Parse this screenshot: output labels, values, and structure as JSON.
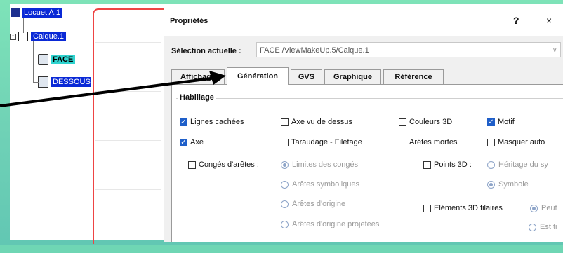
{
  "tree": {
    "root": "Locuet A.1",
    "calque": "Calque.1",
    "face": "FACE",
    "dessous": "DESSOUS"
  },
  "dialog": {
    "title": "Propriétés",
    "help": "?",
    "close": "×",
    "selection_label": "Sélection actuelle :",
    "selection_value": "FACE /ViewMakeUp.5/Calque.1",
    "tabs": [
      "Affichage",
      "Génération",
      "GVS",
      "Graphique",
      "Référence"
    ],
    "active_tab": "Génération",
    "group_title": "Habillage",
    "options": {
      "lignes_cachees": "Lignes cachées",
      "axe_vu_dessus": "Axe vu de dessus",
      "couleurs_3d": "Couleurs 3D",
      "motif": "Motif",
      "axe": "Axe",
      "taraudage": "Taraudage - Filetage",
      "aretes_mortes": "Arêtes mortes",
      "masquer_auto": "Masquer auto",
      "conges_aretes": "Congés d'arêtes :",
      "limites_conges": "Limites des congés",
      "aretes_symboliques": "Arêtes symboliques",
      "aretes_origine": "Arêtes d'origine",
      "aretes_origine_proj": "Arêtes d'origine projetées",
      "points_3d": "Points 3D :",
      "heritage": "Héritage du sy",
      "symbole": "Symbole",
      "elements_3d": "Eléments 3D filaires",
      "peut": "Peut",
      "est": "Est ti"
    }
  }
}
